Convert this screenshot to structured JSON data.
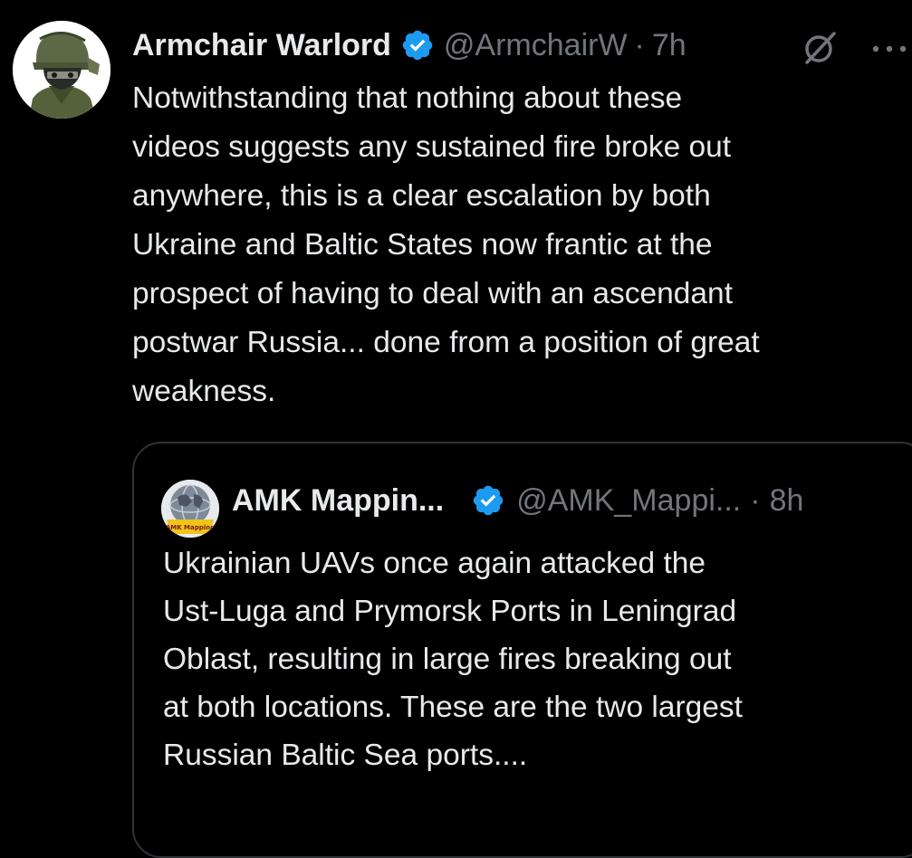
{
  "tweet": {
    "author": {
      "display_name": "Armchair Warlord",
      "handle": "@ArmchairW",
      "avatar_icon": "armchair-warlord-avatar",
      "verified": true
    },
    "separator": "·",
    "time": "7h",
    "grok_icon": "grok-icon",
    "more_icon": "more-icon",
    "text": "Notwithstanding that nothing about these\nvideos suggests any sustained fire broke out\nanywhere, this is a clear escalation by both\nUkraine and Baltic States now frantic at the\nprospect of having to deal with an ascendant\npostwar Russia... done from a position of great\nweakness.",
    "quoted": {
      "author": {
        "display_name": "AMK Mappin...",
        "handle": "@AMK_Mappi...",
        "avatar_icon": "amk-mapping-avatar",
        "avatar_label": "AMK Mapping",
        "verified": true
      },
      "separator": "·",
      "time": "8h",
      "text": "Ukrainian UAVs once again attacked the\nUst-Luga and Prymorsk Ports in Leningrad\nOblast, resulting in large fires breaking out\nat both locations. These are the two largest\nRussian Baltic Sea ports...."
    }
  },
  "colors": {
    "background": "#000000",
    "primary_text": "#e7e9ea",
    "secondary_text": "#71767b",
    "verified_blue": "#1d9bf0",
    "border": "#2f3336"
  }
}
